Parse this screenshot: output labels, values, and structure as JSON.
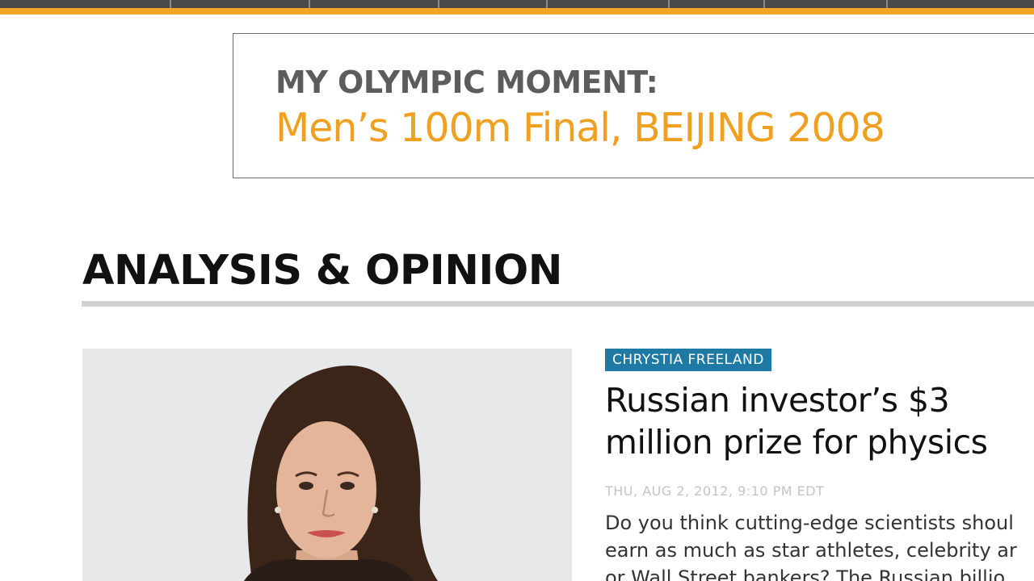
{
  "banner": {
    "title": "MY OLYMPIC MOMENT:",
    "subtitle": "Men’s 100m Final, BEIJING 2008"
  },
  "section": {
    "title": "ANALYSIS & OPINION"
  },
  "article": {
    "author": "CHRYSTIA FREELAND",
    "headline_line1": "Russian investor’s $3",
    "headline_line2": "million prize for physics",
    "timestamp": "THU, AUG 2, 2012, 9:10 PM EDT",
    "summary_line1": "Do you think cutting-edge scientists shoul",
    "summary_line2": "earn as much as star athletes, celebrity ar",
    "summary_line3": "or Wall Street bankers? The Russian billio"
  },
  "colors": {
    "nav_dark": "#4a4a4a",
    "accent_orange": "#f4a623",
    "banner_subtitle": "#f0a020",
    "badge_blue": "#1f7aa3"
  },
  "icons": {
    "photo": "author-portrait"
  }
}
